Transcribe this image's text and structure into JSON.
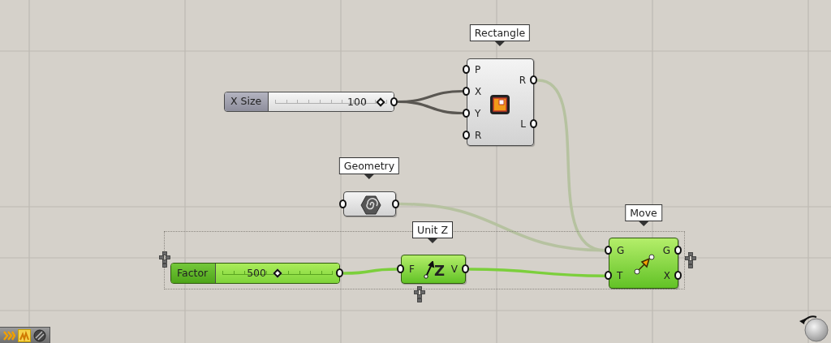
{
  "canvas": {
    "nodes": [
      {
        "kind": "component",
        "tooltip": "Rectangle",
        "selected": false,
        "inputs": [
          "P",
          "X",
          "Y",
          "R"
        ],
        "outputs": [
          "R",
          "L"
        ]
      },
      {
        "kind": "slider",
        "label": "X Size",
        "value": "100",
        "level": 0.92,
        "selected": false
      },
      {
        "kind": "param",
        "tooltip": "Geometry",
        "selected": false
      },
      {
        "kind": "slider",
        "label": "Factor",
        "value": "500",
        "level": 0.5,
        "selected": true
      },
      {
        "kind": "component",
        "tooltip": "Unit Z",
        "selected": true,
        "inputs": [
          "F"
        ],
        "outputs": [
          "V"
        ],
        "icon_text": "Z"
      },
      {
        "kind": "component",
        "tooltip": "Move",
        "selected": true,
        "inputs": [
          "G",
          "T"
        ],
        "outputs": [
          "G",
          "X"
        ]
      }
    ]
  }
}
